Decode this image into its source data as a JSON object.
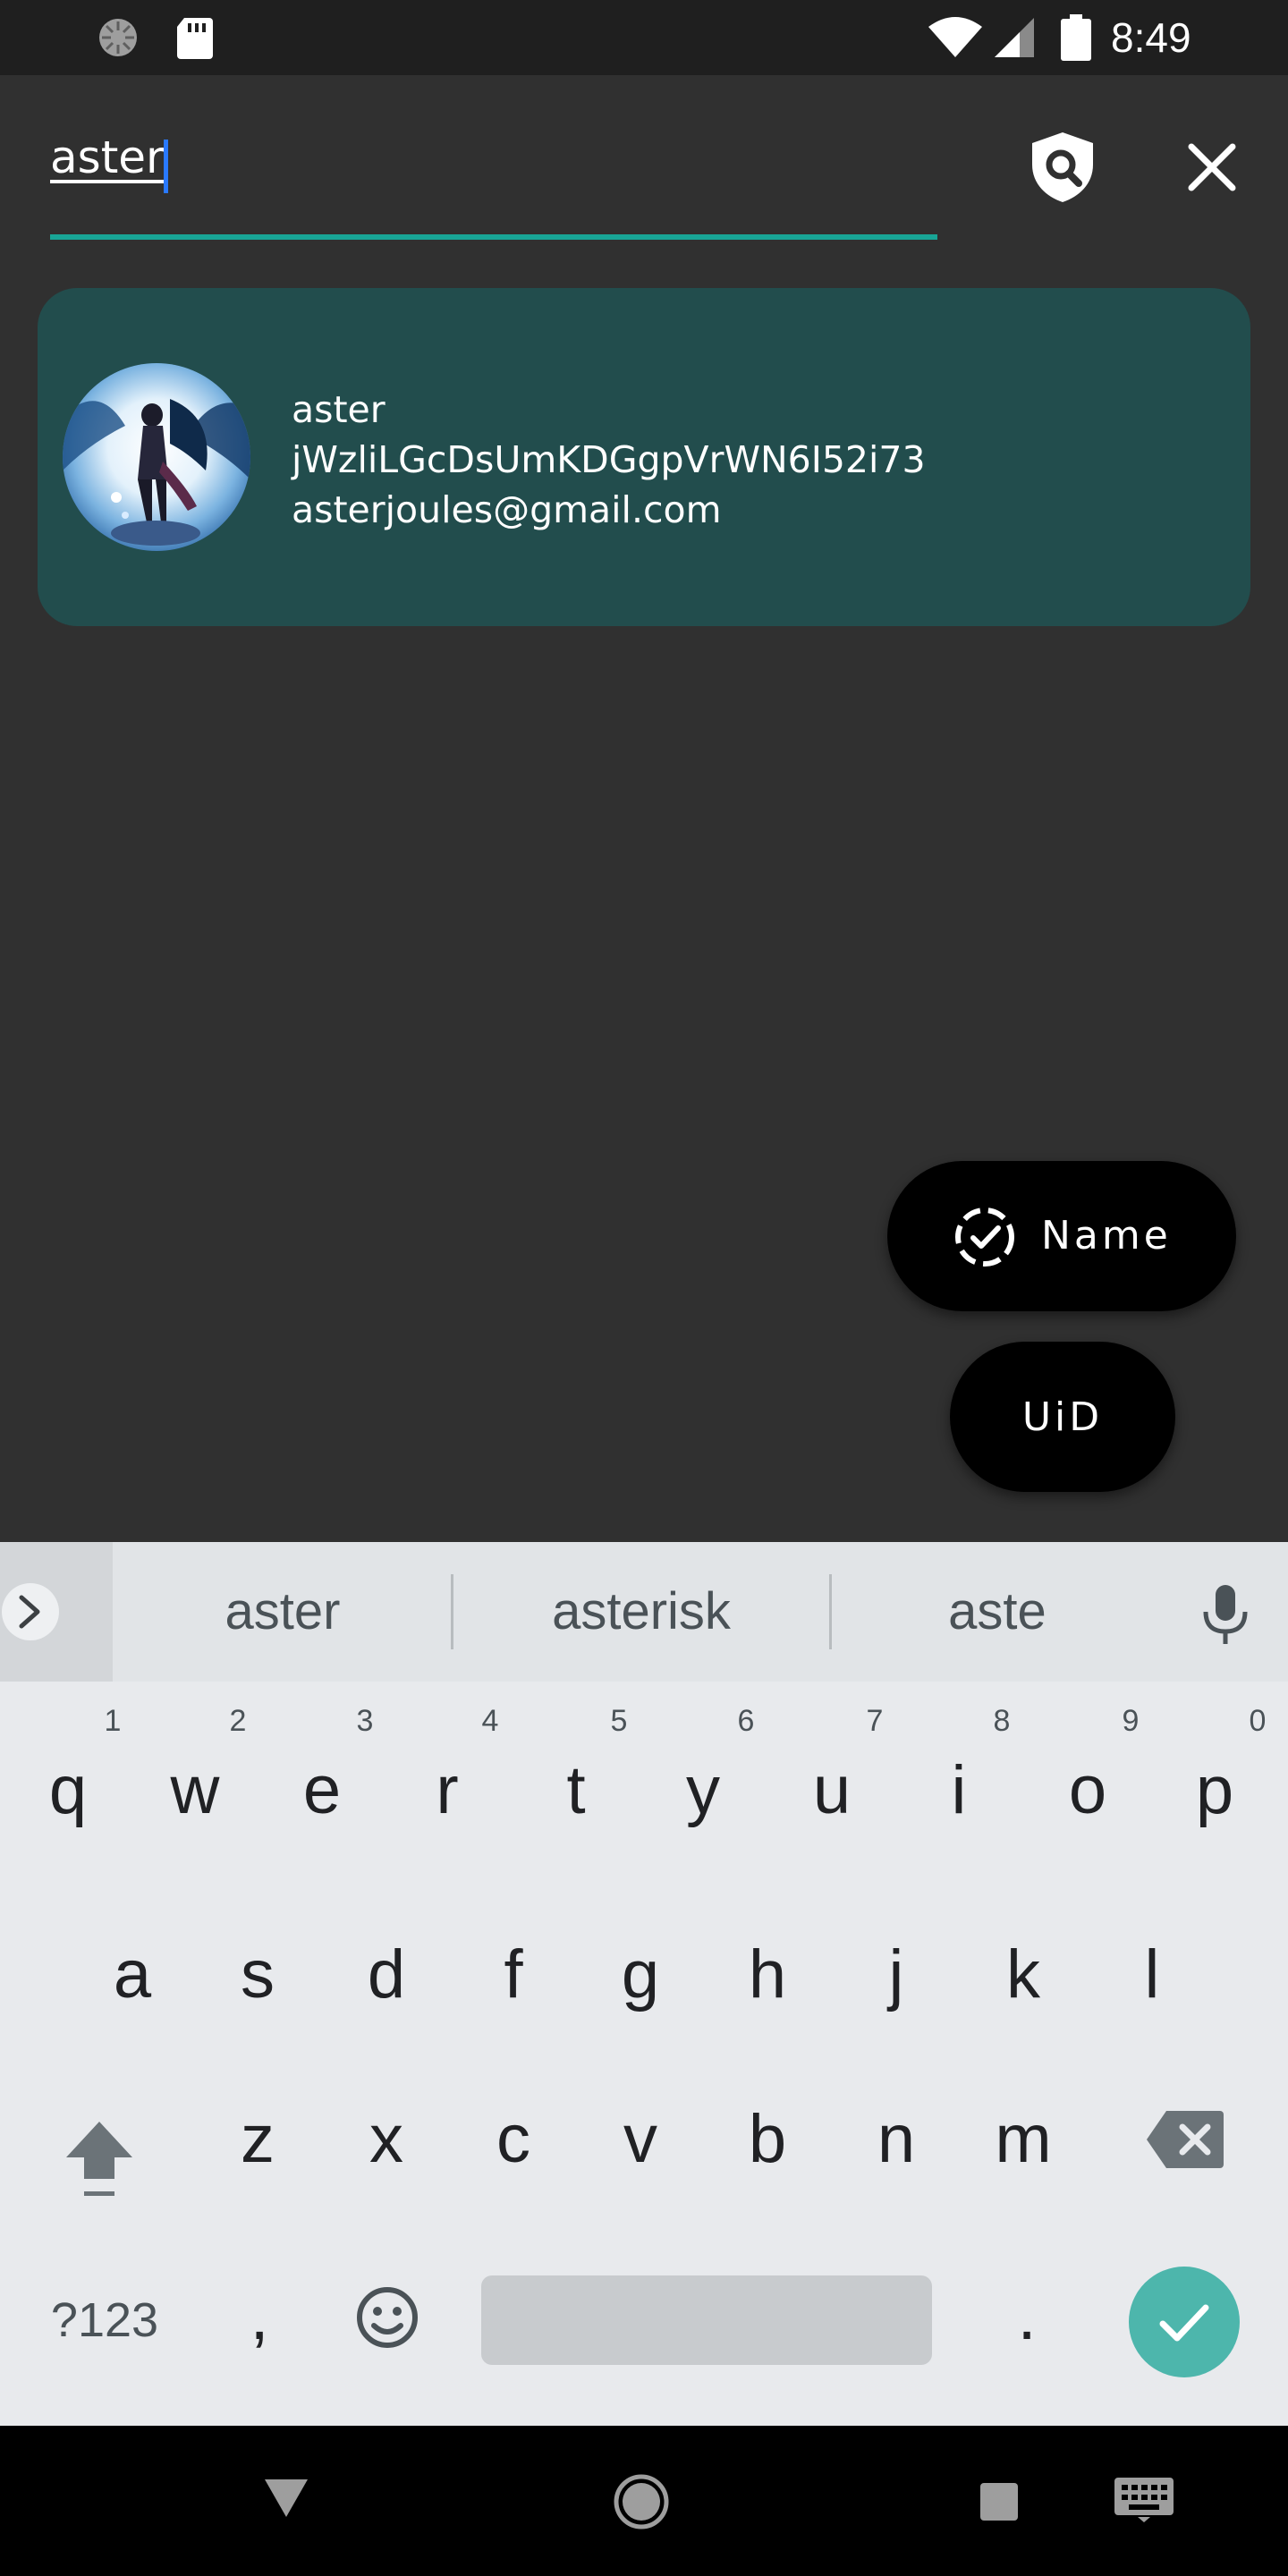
{
  "status_bar": {
    "time": "8:49",
    "icons": [
      "sync-icon",
      "sd-card-icon",
      "wifi-icon",
      "cell-signal-icon",
      "battery-icon"
    ]
  },
  "search": {
    "query": "aster",
    "accent_color": "#18a596",
    "caret_color": "#2979ff"
  },
  "header_actions": {
    "search_mode_icon": "shield-search-icon",
    "close_icon": "close-icon"
  },
  "results": [
    {
      "name": "aster",
      "uid": "jWzliLGcDsUmKDGgpVrWN6I52i73",
      "email": "asterjoules@gmail.com",
      "avatar_icon": "avatar-anime-character",
      "card_color": "#224d4d"
    }
  ],
  "fabs": {
    "name_label": "Name",
    "name_icon": "dashed-check-circle-icon",
    "uid_label": "UiD"
  },
  "keyboard": {
    "suggestions": [
      "aster",
      "asterisk",
      "aste"
    ],
    "row1": [
      "q",
      "w",
      "e",
      "r",
      "t",
      "y",
      "u",
      "i",
      "o",
      "p"
    ],
    "row1_hints": [
      "1",
      "2",
      "3",
      "4",
      "5",
      "6",
      "7",
      "8",
      "9",
      "0"
    ],
    "row2": [
      "a",
      "s",
      "d",
      "f",
      "g",
      "h",
      "j",
      "k",
      "l"
    ],
    "row3": [
      "z",
      "x",
      "c",
      "v",
      "b",
      "n",
      "m"
    ],
    "symbols_label": "?123",
    "comma": ",",
    "period": ".",
    "enter_color": "#4db6ac"
  },
  "nav_bar": {
    "icons": [
      "back-icon",
      "home-icon",
      "recents-icon",
      "keyboard-switch-icon"
    ]
  }
}
